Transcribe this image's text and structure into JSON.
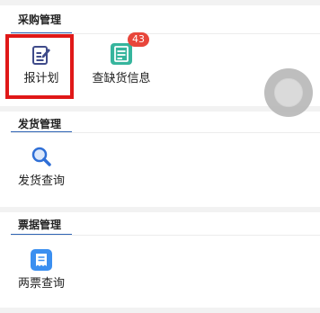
{
  "sections": [
    {
      "title": "采购管理",
      "items": [
        {
          "label": "报计划",
          "icon": "edit-plan-icon"
        },
        {
          "label": "查缺货信息",
          "icon": "stockout-list-icon",
          "badge": "43"
        }
      ]
    },
    {
      "title": "发货管理",
      "items": [
        {
          "label": "发货查询",
          "icon": "search-icon"
        }
      ]
    },
    {
      "title": "票据管理",
      "items": [
        {
          "label": "两票查询",
          "icon": "receipt-icon"
        }
      ]
    }
  ],
  "colors": {
    "accent_underline": "#2e64b5",
    "highlight": "#e01818",
    "badge": "#e8463b",
    "edit_icon": "#3f4b8a",
    "stockout_icon": "#36b59d",
    "search_icon": "#2f6fd6",
    "receipt_icon": "#3b8ff0"
  }
}
